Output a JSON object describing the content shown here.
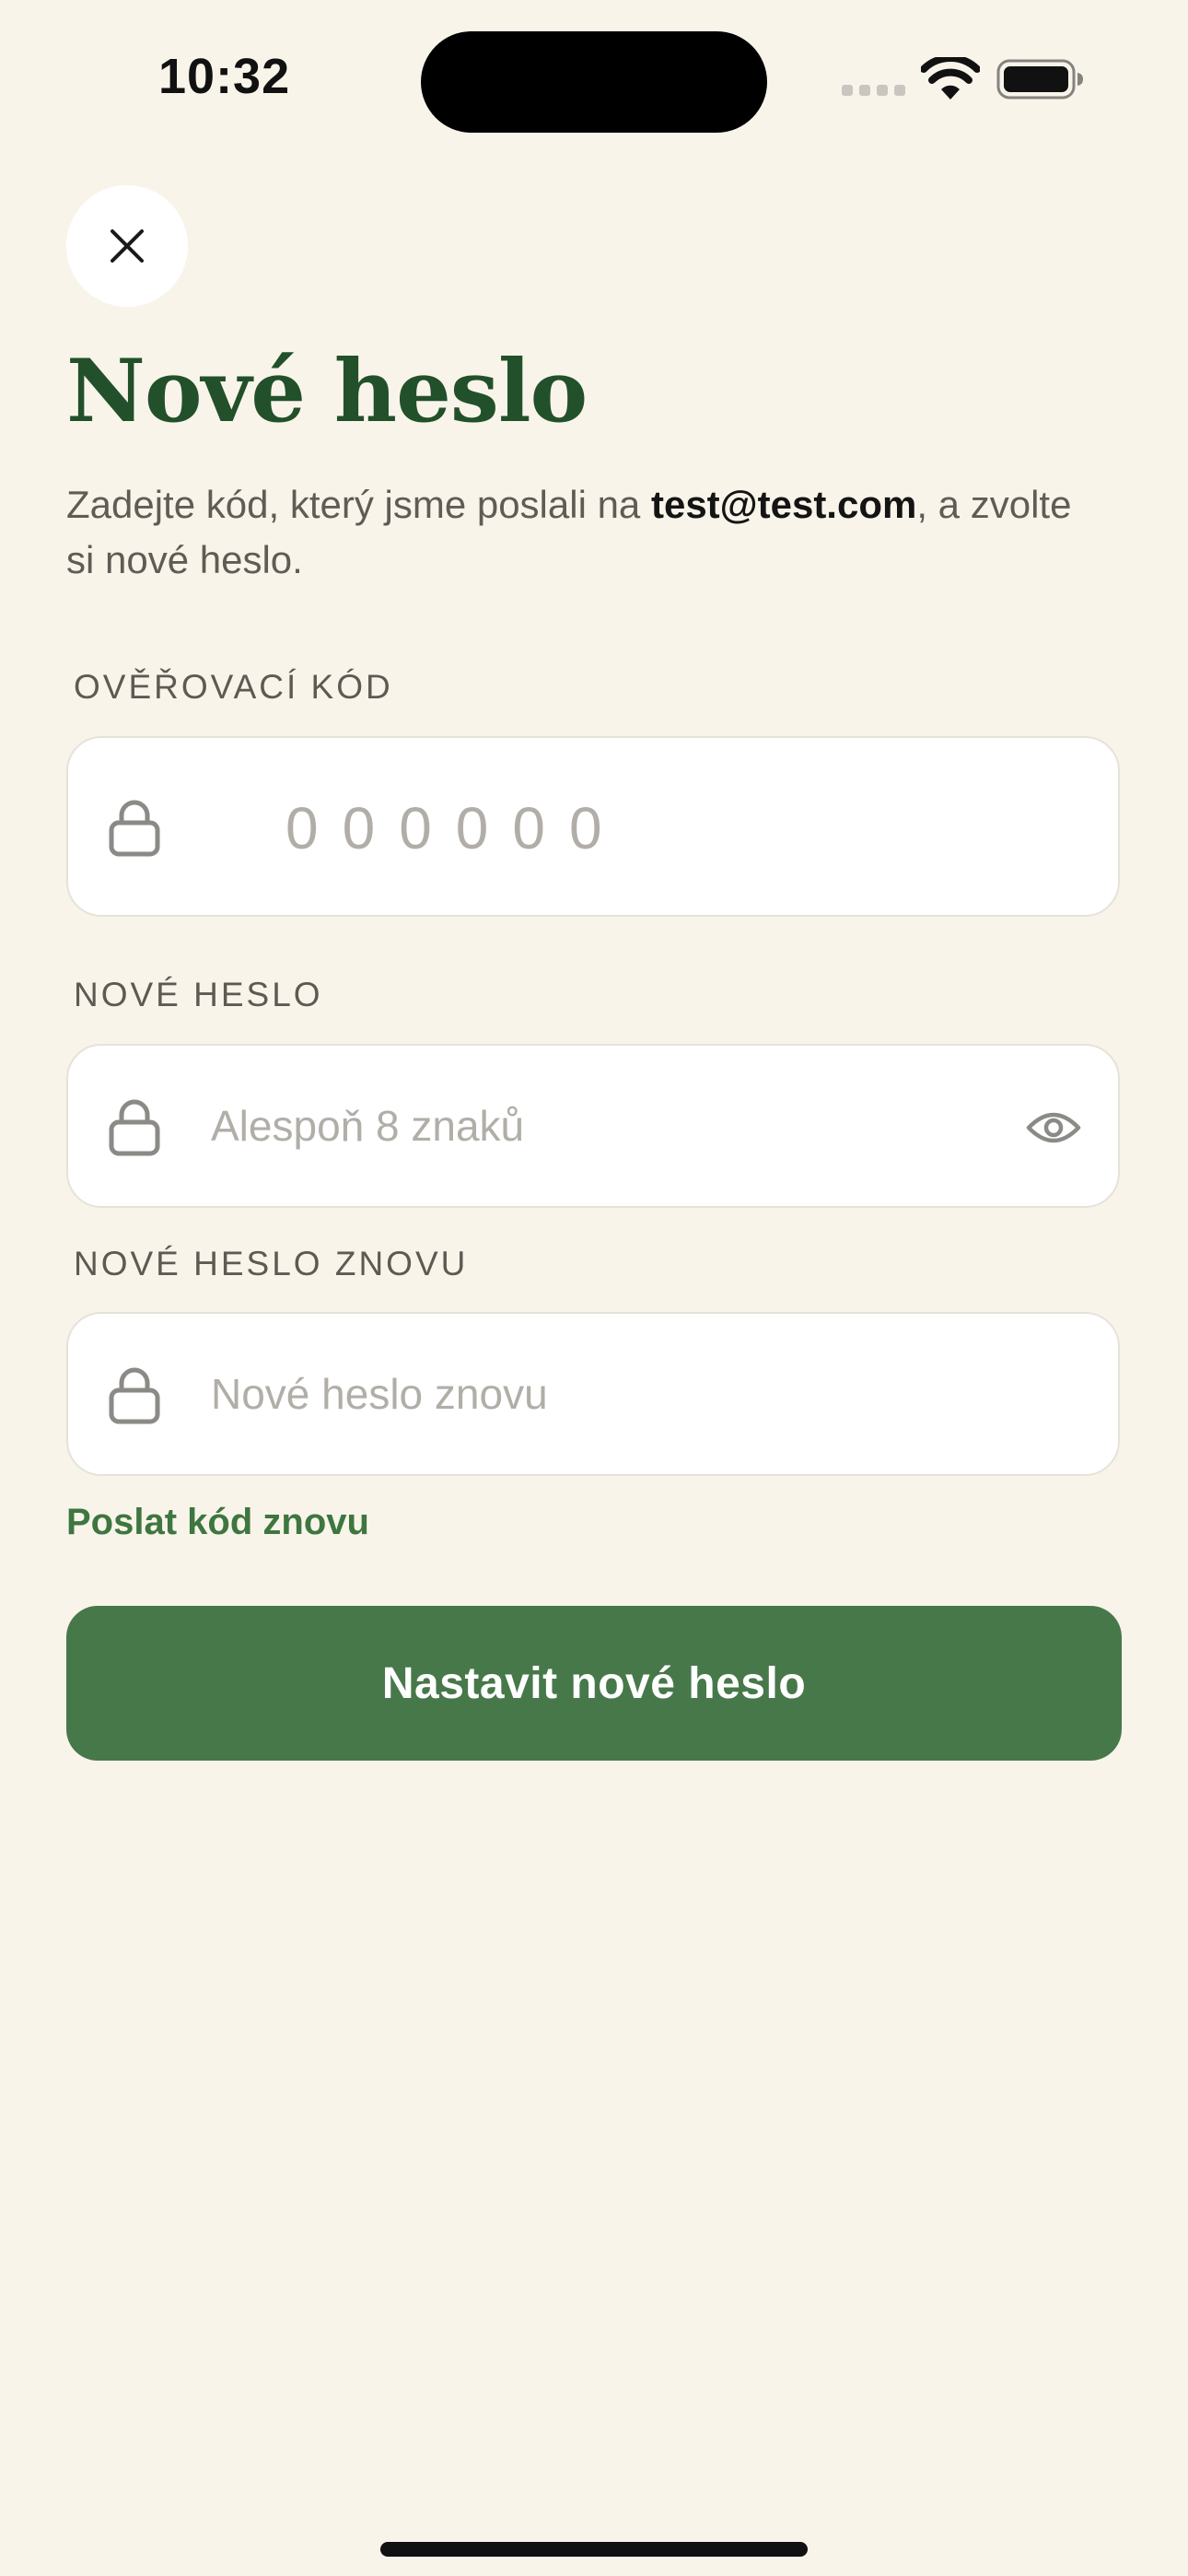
{
  "status_bar": {
    "time": "10:32"
  },
  "header": {
    "title": "Nové heslo",
    "subtitle_before": "Zadejte kód, který jsme poslali na ",
    "email": "test@test.com",
    "subtitle_after": ", a zvolte si nové heslo."
  },
  "form": {
    "code": {
      "label": "OVĚŘOVACÍ KÓD",
      "placeholder": "000000"
    },
    "new_password": {
      "label": "NOVÉ HESLO",
      "placeholder": "Alespoň 8 znaků"
    },
    "confirm_password": {
      "label": "NOVÉ HESLO ZNOVU",
      "placeholder": "Nové heslo znovu"
    },
    "resend_label": "Poslat kód znovu",
    "submit_label": "Nastavit nové heslo"
  },
  "icons": {
    "close": "close-icon",
    "lock": "lock-icon",
    "eye": "eye-icon",
    "signal": "signal-icon",
    "wifi": "wifi-icon",
    "battery": "battery-icon"
  },
  "colors": {
    "background": "#f9f4ea",
    "title": "#22502a",
    "primary_button": "#47784a",
    "link": "#3e7640"
  }
}
